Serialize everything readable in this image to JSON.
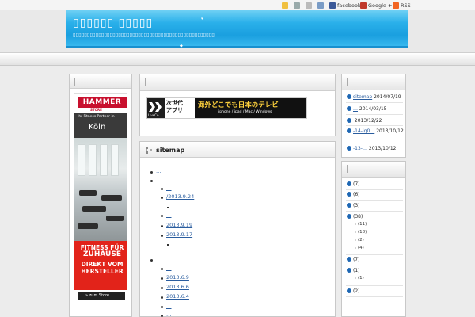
{
  "topbar": {
    "items": [
      "facebook",
      "Google +1",
      "RSS"
    ],
    "colors": {
      "facebook": "#3b5998",
      "google": "#c0392b",
      "rss": "#f26522"
    }
  },
  "header": {
    "site_title": "▯▯▯▯▯▯ ▯▯▯▯▯",
    "site_description": "▯▯▯▯▯▯▯▯▯▯▯▯▯▯▯▯▯▯▯▯▯▯▯▯▯▯▯▯▯▯▯▯▯▯▯▯▯▯▯▯▯▯▯▯▯▯▯▯▯▯",
    "accent": "#1a9fdf"
  },
  "left_ad": {
    "brand": "HAMMER",
    "brand_sub": "STORE",
    "tagline": "Ihr Fitness-Partner in",
    "city": "Köln",
    "headline_1": "FITNESS FÜR",
    "headline_2": "ZUHAUSE",
    "headline_3": "DIREKT VOM",
    "headline_4": "HERSTELLER",
    "button": "zum Store"
  },
  "middle_ad": {
    "logo": "LiveCo",
    "label_1": "次世代",
    "label_2": "アプリ",
    "headline": "海外どこでも日本のテレビ",
    "devices": "iphone / ipad / Mac / Windows"
  },
  "sitemap": {
    "title": "sitemap",
    "group1": {
      "item": "…",
      "children": [
        "…",
        "/2013.9.24",
        "",
        "…",
        " 2013.9.19",
        " 2013.9.17",
        ""
      ]
    },
    "group2": {
      "children": [
        "…",
        " 2013.6.9",
        " 2013.6.6",
        " 2013.6.4",
        "…",
        "…"
      ]
    }
  },
  "recent_posts": [
    {
      "link": "sitemap",
      "date": "2014/07/19"
    },
    {
      "link": "…",
      "date": "2014/03/15"
    },
    {
      "link": "",
      "date": "2013/12/22"
    },
    {
      "link": "-14-ig0…",
      "date": "2013/10/12"
    },
    {
      "link": "-13-…",
      "date": "2013/10/12"
    }
  ],
  "categories": [
    {
      "label": "(7)"
    },
    {
      "label": "(6)"
    },
    {
      "label": "(3)"
    },
    {
      "label": "(38)",
      "children": [
        "(11)",
        "(18)",
        "(2)",
        "(4)"
      ]
    },
    {
      "label": "(7)"
    },
    {
      "label": "(1)",
      "children": [
        "(1)"
      ]
    },
    {
      "label": "(2)"
    }
  ]
}
